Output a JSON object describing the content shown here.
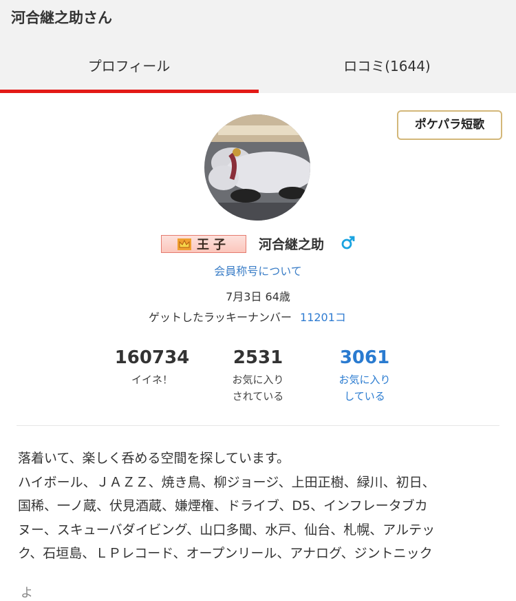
{
  "header": {
    "title": "河合継之助さん",
    "tabs": [
      {
        "label": "プロフィール",
        "active": true
      },
      {
        "label": "ロコミ(1644)",
        "active": false
      }
    ],
    "active_color": "#e31a17"
  },
  "profile": {
    "tanka_button": "ポケパラ短歌",
    "badge": "王子",
    "name": "河合継之助",
    "gender_icon": "male-icon",
    "title_link": "会員称号について",
    "birth_age": "7月3日 64歳",
    "lucky_label": "ゲットしたラッキーナンバー",
    "lucky_value": "11201コ"
  },
  "stats": [
    {
      "value": "160734",
      "label_lines": [
        "イイネ！"
      ]
    },
    {
      "value": "2531",
      "label_lines": [
        "お気に入り",
        "されている"
      ]
    },
    {
      "value": "3061",
      "label_lines": [
        "お気に入り",
        "している"
      ],
      "link": true
    }
  ],
  "bio": [
    "落着いて、楽しく呑める空間を探しています。",
    "ハイボール、ＪＡＺＺ、焼き鳥、柳ジョージ、上田正樹、緑川、初日、",
    "国稀、一ノ蔵、伏見酒蔵、嫌煙権、ドライブ、D5、インフレータブカ",
    "ヌー、スキューバダイビング、山口多聞、水戸、仙台、札幌、アルテッ",
    "ク、石垣島、ＬＰレコード、オープンリール、アナログ、ジントニック"
  ],
  "cutoff_text": "よ",
  "colors": {
    "link": "#2e7bd1",
    "accent": "#e31a17",
    "badge_border": "#d3b779"
  }
}
